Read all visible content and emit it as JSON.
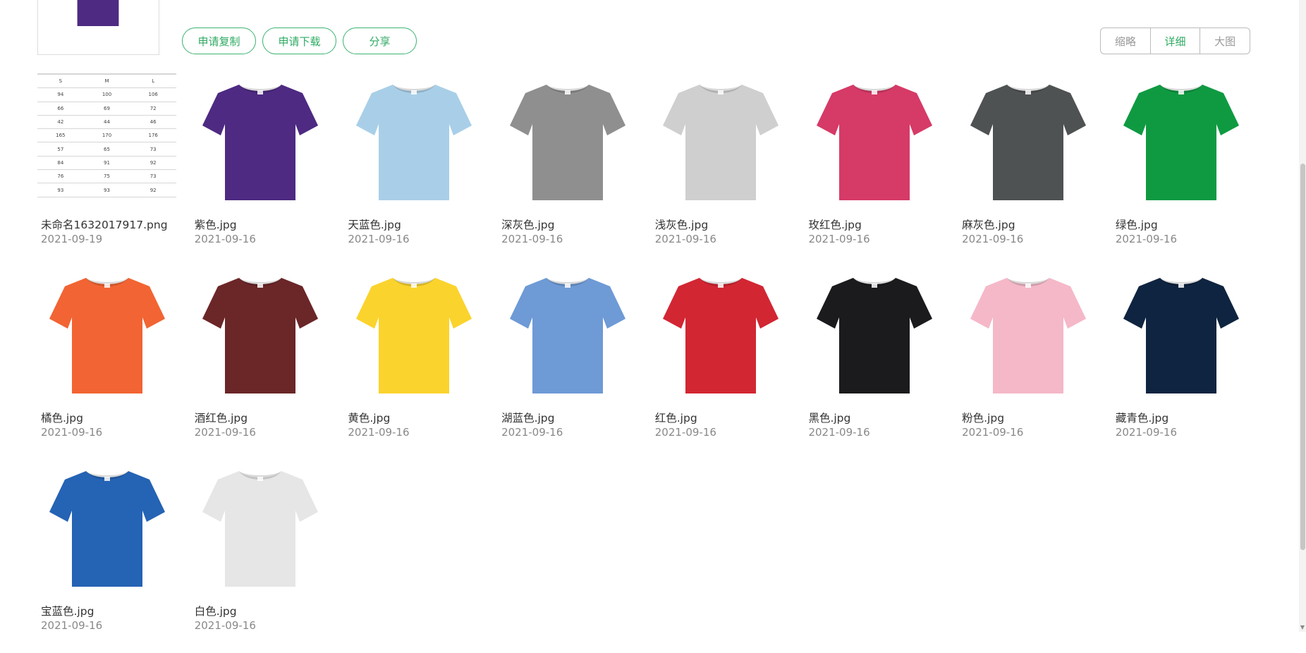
{
  "toolbar": {
    "copy_label": "申请复制",
    "download_label": "申请下载",
    "share_label": "分享"
  },
  "view_modes": [
    {
      "label": "缩略",
      "active": false
    },
    {
      "label": "详细",
      "active": true
    },
    {
      "label": "大图",
      "active": false
    }
  ],
  "size_chart": {
    "rows": [
      [
        "S",
        "M",
        "L"
      ],
      [
        "94",
        "100",
        "106"
      ],
      [
        "66",
        "69",
        "72"
      ],
      [
        "42",
        "44",
        "46"
      ],
      [
        "165",
        "170",
        "176"
      ],
      [
        "57",
        "65",
        "73"
      ],
      [
        "84",
        "91",
        "92"
      ],
      [
        "76",
        "75",
        "73"
      ],
      [
        "93",
        "93",
        "92"
      ]
    ]
  },
  "files": [
    {
      "name": "未命名1632017917.png",
      "date": "2021-09-19",
      "type": "size-chart"
    },
    {
      "name": "紫色.jpg",
      "date": "2021-09-16",
      "color": "#4e2a82"
    },
    {
      "name": "天蓝色.jpg",
      "date": "2021-09-16",
      "color": "#a9cfe8"
    },
    {
      "name": "深灰色.jpg",
      "date": "2021-09-16",
      "color": "#8f8f8f"
    },
    {
      "name": "浅灰色.jpg",
      "date": "2021-09-16",
      "color": "#cfcfcf"
    },
    {
      "name": "玫红色.jpg",
      "date": "2021-09-16",
      "color": "#d63a67"
    },
    {
      "name": "麻灰色.jpg",
      "date": "2021-09-16",
      "color": "#4f5253"
    },
    {
      "name": "绿色.jpg",
      "date": "2021-09-16",
      "color": "#0f9a42"
    },
    {
      "name": "橘色.jpg",
      "date": "2021-09-16",
      "color": "#f26433"
    },
    {
      "name": "酒红色.jpg",
      "date": "2021-09-16",
      "color": "#6b2628"
    },
    {
      "name": "黄色.jpg",
      "date": "2021-09-16",
      "color": "#fbd32d"
    },
    {
      "name": "湖蓝色.jpg",
      "date": "2021-09-16",
      "color": "#6e9ad6"
    },
    {
      "name": "红色.jpg",
      "date": "2021-09-16",
      "color": "#d22633"
    },
    {
      "name": "黑色.jpg",
      "date": "2021-09-16",
      "color": "#1b1b1e"
    },
    {
      "name": "粉色.jpg",
      "date": "2021-09-16",
      "color": "#f5b8c8"
    },
    {
      "name": "藏青色.jpg",
      "date": "2021-09-16",
      "color": "#0f2440"
    },
    {
      "name": "宝蓝色.jpg",
      "date": "2021-09-16",
      "color": "#2563b4"
    },
    {
      "name": "白色.jpg",
      "date": "2021-09-16",
      "color": "#e6e6e6"
    }
  ],
  "top_partial_thumb": {
    "color": "#4e2a82"
  }
}
